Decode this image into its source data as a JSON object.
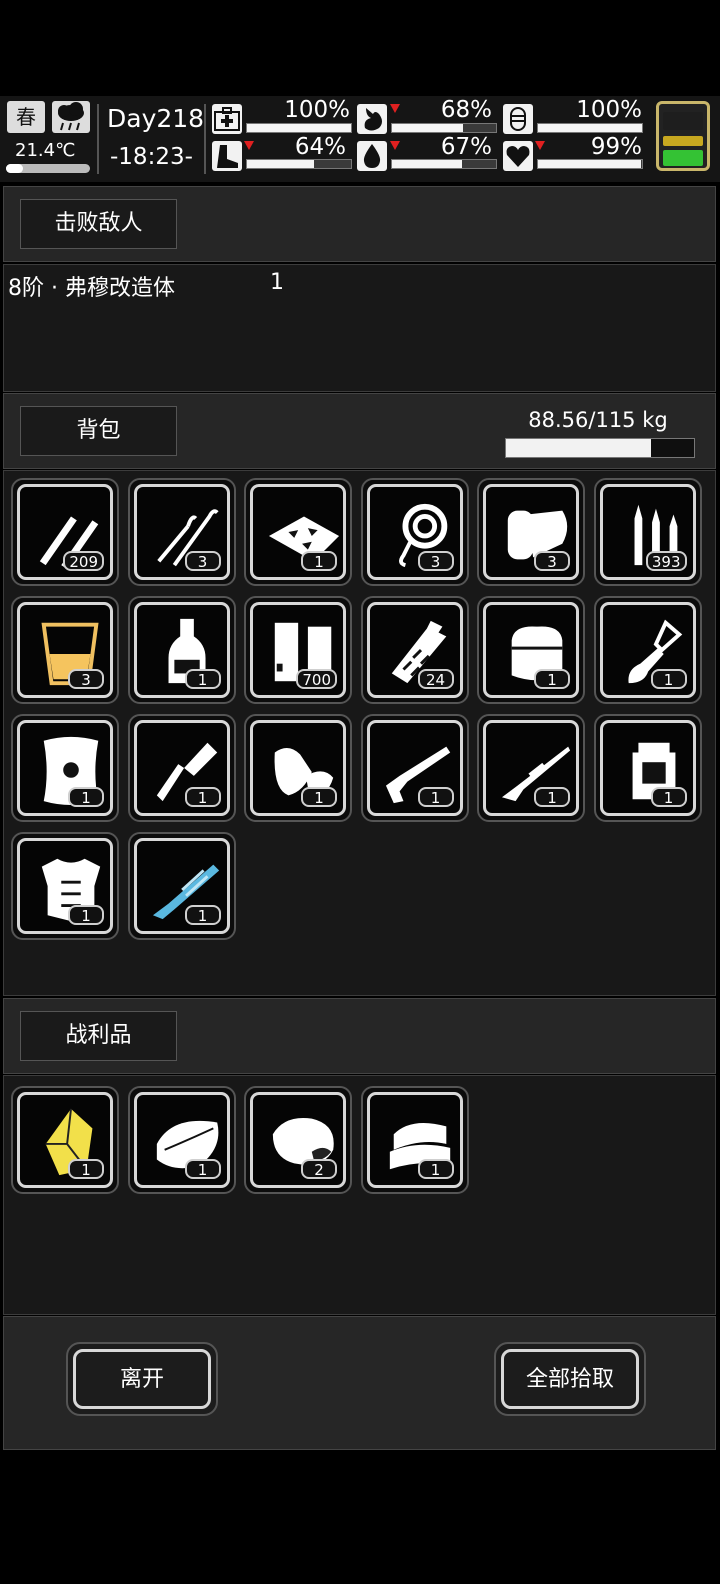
{
  "status": {
    "season": "春",
    "temperature": "21.4℃",
    "temperature_level": 0.2,
    "day": "Day218",
    "time": "-18:23-",
    "stats": [
      {
        "icon": "medkit-icon",
        "value": "100%",
        "level": 1.0,
        "down": false
      },
      {
        "icon": "stomach-icon",
        "value": "68%",
        "level": 0.68,
        "down": true
      },
      {
        "icon": "brain-icon",
        "value": "100%",
        "level": 1.0,
        "down": false
      },
      {
        "icon": "boot-icon",
        "value": "64%",
        "level": 0.64,
        "down": true
      },
      {
        "icon": "water-drop-icon",
        "value": "67%",
        "level": 0.67,
        "down": true
      },
      {
        "icon": "heart-icon",
        "value": "99%",
        "level": 0.99,
        "down": true
      }
    ],
    "battery_colors": [
      "#c8a820",
      "#34c234"
    ]
  },
  "defeated": {
    "title": "击败敌人",
    "enemy_name": "8阶 · 弗穆改造体",
    "enemy_count": "1"
  },
  "backpack": {
    "title": "背包",
    "weight": "88.56/115 kg",
    "weight_level": 0.77,
    "items": [
      {
        "icon": "rifle-bullets-icon",
        "count": "209"
      },
      {
        "icon": "lockpick-icon",
        "count": "3"
      },
      {
        "icon": "glass-shards-icon",
        "count": "1"
      },
      {
        "icon": "rope-icon",
        "count": "3"
      },
      {
        "icon": "bandage-icon",
        "count": "3"
      },
      {
        "icon": "ammo-cartridges-icon",
        "count": "393"
      },
      {
        "icon": "juice-glass-icon",
        "count": "3"
      },
      {
        "icon": "liquor-bottle-icon",
        "count": "1"
      },
      {
        "icon": "paper-slips-icon",
        "count": "700"
      },
      {
        "icon": "grenade-icon",
        "count": "24"
      },
      {
        "icon": "fur-bag-icon",
        "count": "1"
      },
      {
        "icon": "shovel-icon",
        "count": "1"
      },
      {
        "icon": "shield-icon",
        "count": "1"
      },
      {
        "icon": "combat-knife-icon",
        "count": "1"
      },
      {
        "icon": "gloves-icon",
        "count": "1"
      },
      {
        "icon": "shotgun-icon",
        "count": "1"
      },
      {
        "icon": "sniper-rifle-icon",
        "count": "1"
      },
      {
        "icon": "backpack-icon",
        "count": "1"
      },
      {
        "icon": "body-armor-icon",
        "count": "1"
      },
      {
        "icon": "minigun-icon",
        "count": "1"
      }
    ]
  },
  "loot": {
    "title": "战利品",
    "items": [
      {
        "icon": "yellow-crystal-icon",
        "count": "1"
      },
      {
        "icon": "cloth-icon",
        "count": "1"
      },
      {
        "icon": "meat-chunk-icon",
        "count": "2"
      },
      {
        "icon": "folded-cloth-icon",
        "count": "1"
      }
    ]
  },
  "actions": {
    "leave": "离开",
    "take_all": "全部拾取"
  }
}
